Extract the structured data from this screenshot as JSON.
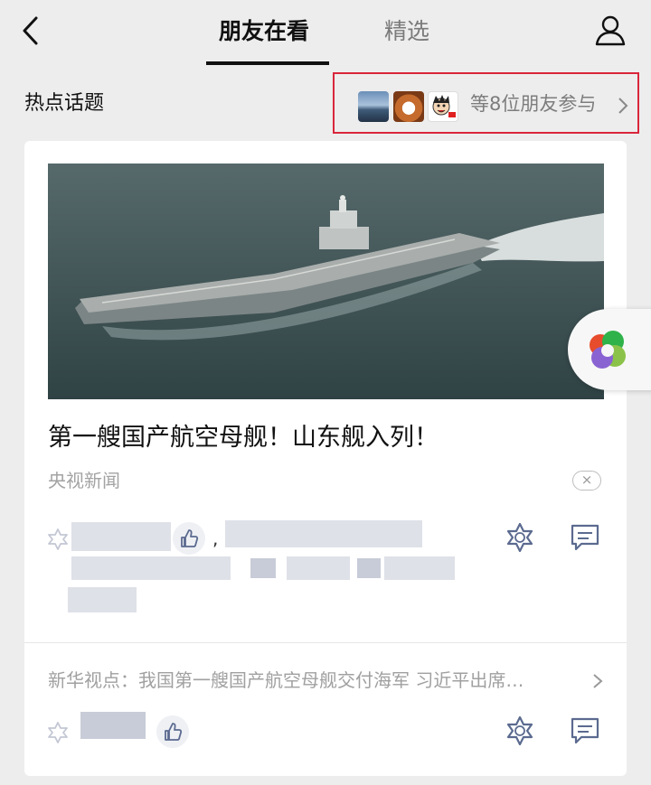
{
  "nav": {
    "tabs": [
      {
        "label": "朋友在看",
        "active": true
      },
      {
        "label": "精选",
        "active": false
      }
    ],
    "back_icon": "chevron-left-icon",
    "profile_icon": "person-icon"
  },
  "hot_topic": {
    "title": "热点话题",
    "friends_text": "等8位朋友参与",
    "highlight_color": "#d9263b"
  },
  "article": {
    "headline": "第一艘国产航空母舰！山东舰入列！",
    "source": "央视新闻",
    "dismiss_label": "×",
    "separator": ","
  },
  "related": {
    "text": "新华视点：我国第一艘国产航空母舰交付海军 习近平出席…"
  },
  "colors": {
    "background": "#ededed",
    "icon_accent": "#5b6a8f"
  }
}
